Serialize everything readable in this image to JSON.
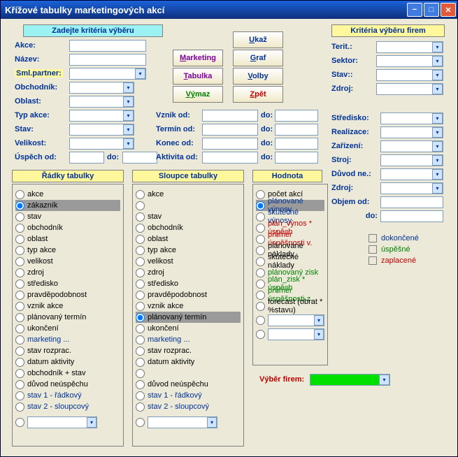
{
  "window": {
    "title": "Křížové tabulky marketingových akcí"
  },
  "panels": {
    "criteria_title": "Zadejte kritéria výběru",
    "firm_criteria_title": "Kritéria výběru firem",
    "rows_title": "Řádky tabulky",
    "cols_title": "Sloupce tabulky",
    "value_title": "Hodnota"
  },
  "labels": {
    "akce": "Akce:",
    "nazev": "Název:",
    "smlpartner": "Sml.partner:",
    "obchodnik": "Obchodník:",
    "oblast": "Oblast:",
    "typakce": "Typ akce:",
    "stav": "Stav:",
    "velikost": "Velikost:",
    "uspech_od": "Úspěch od:",
    "do": "do:",
    "vznik_od": "Vznik od:",
    "termin_od": "Termín od:",
    "konec_od": "Konec od:",
    "aktivita_od": "Aktivita od:"
  },
  "buttons": {
    "marketing": "arketing",
    "marketing_pre": "M",
    "tabulka": "abulka",
    "tabulka_pre": "T",
    "vymaz": "maz",
    "vymaz_pre": "Vý",
    "ukaz": "kaž",
    "ukaz_pre": "U",
    "graf": "raf",
    "graf_pre": "G",
    "volby": "olby",
    "volby_pre": "V",
    "zpet": "pět",
    "zpet_pre": "Z"
  },
  "firm": {
    "terit": "Terit.:",
    "sektor": "Sektor:",
    "stav": "Stav::",
    "zdroj": "Zdroj:",
    "stredisko": "Středisko:",
    "realizace": "Realizace:",
    "zarizeni": "Zařízení:",
    "stroj": "Stroj:",
    "duvod_ne": "Důvod ne.:",
    "zdroj2": "Zdroj:",
    "objem_od": "Objem od:",
    "do": "do:"
  },
  "check": {
    "dokoncene": "dokončené",
    "uspesne": "úspěšné",
    "zaplacene": "zaplacené"
  },
  "firm_select": {
    "label": "Výběr firem:"
  },
  "rows_opts": [
    "akce",
    "zákazník",
    "stav",
    "obchodník",
    "oblast",
    "typ akce",
    "velikost",
    "zdroj",
    "středisko",
    "pravděpodobnost",
    "vznik akce",
    "plánovaný termín",
    "ukončení",
    "marketing ...",
    "stav rozprac.",
    "datum aktivity",
    "obchodník + stav",
    "důvod neúspěchu",
    "stav 1 - řádkový",
    "stav 2 - sloupcový"
  ],
  "rows_colors": {
    "marketing ...": "blue",
    "stav 1 - řádkový": "blue",
    "stav 2 - sloupcový": "blue"
  },
  "rows_selected": "zákazník",
  "cols_opts": [
    "akce",
    "",
    "stav",
    "obchodník",
    "oblast",
    "typ akce",
    "velikost",
    "zdroj",
    "středisko",
    "pravděpodobnost",
    "vznik akce",
    "plánovaný termín",
    "ukončení",
    "marketing ...",
    "stav rozprac.",
    "datum aktivity",
    "",
    "důvod neúspěchu",
    "stav 1 - řádkový",
    "stav 2 - sloupcový"
  ],
  "cols_colors": {
    "marketing ...": "blue",
    "stav 1 - řádkový": "blue",
    "stav 2 - sloupcový": "blue"
  },
  "cols_selected": "plánovaný termín",
  "val_opts": [
    "počet akcí",
    "plánované výnosy",
    "skutečné výnosy",
    "plán_výnos * úspěch",
    "průměr úspěšnosti v.",
    "plánované náklady",
    "skutečné náklady",
    "plánovaný zisk",
    "plán_zisk * úspěch",
    "průměr úspěšnosti z.",
    "forecast (obrat * %stavu)"
  ],
  "val_colors": {
    "plánované výnosy": "blue",
    "skutečné výnosy": "blue",
    "plán_výnos * úspěch": "red",
    "průměr úspěšnosti v.": "red",
    "plánovaný zisk": "green",
    "plán_zisk * úspěch": "green",
    "průměr úspěšnosti z.": "green"
  },
  "val_selected": "plánované výnosy"
}
